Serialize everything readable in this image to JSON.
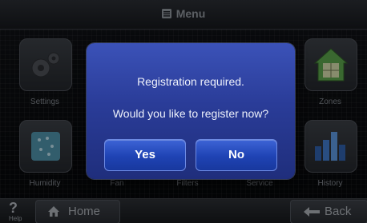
{
  "header": {
    "title": "Menu",
    "icon": "menu-list-icon"
  },
  "tiles": [
    {
      "label": "Settings",
      "icon": "gears-icon"
    },
    {
      "label": "Zones",
      "icon": "house-zones-icon"
    },
    {
      "label": "Humidity",
      "icon": "humidity-icon"
    },
    {
      "label": "Fan",
      "icon": "fan-icon"
    },
    {
      "label": "Filters",
      "icon": "filter-icon"
    },
    {
      "label": "Service",
      "icon": "service-icon"
    },
    {
      "label": "History",
      "icon": "bar-chart-icon"
    }
  ],
  "bottom": {
    "help_label": "Help",
    "help_symbol": "?",
    "home_label": "Home",
    "back_label": "Back"
  },
  "dialog": {
    "message": "Registration required.",
    "question": "Would you like to register now?",
    "yes_label": "Yes",
    "no_label": "No"
  },
  "colors": {
    "dialog_bg": "#2a3c98",
    "button_bg": "#1f43b4",
    "text": "#eef1fb"
  }
}
